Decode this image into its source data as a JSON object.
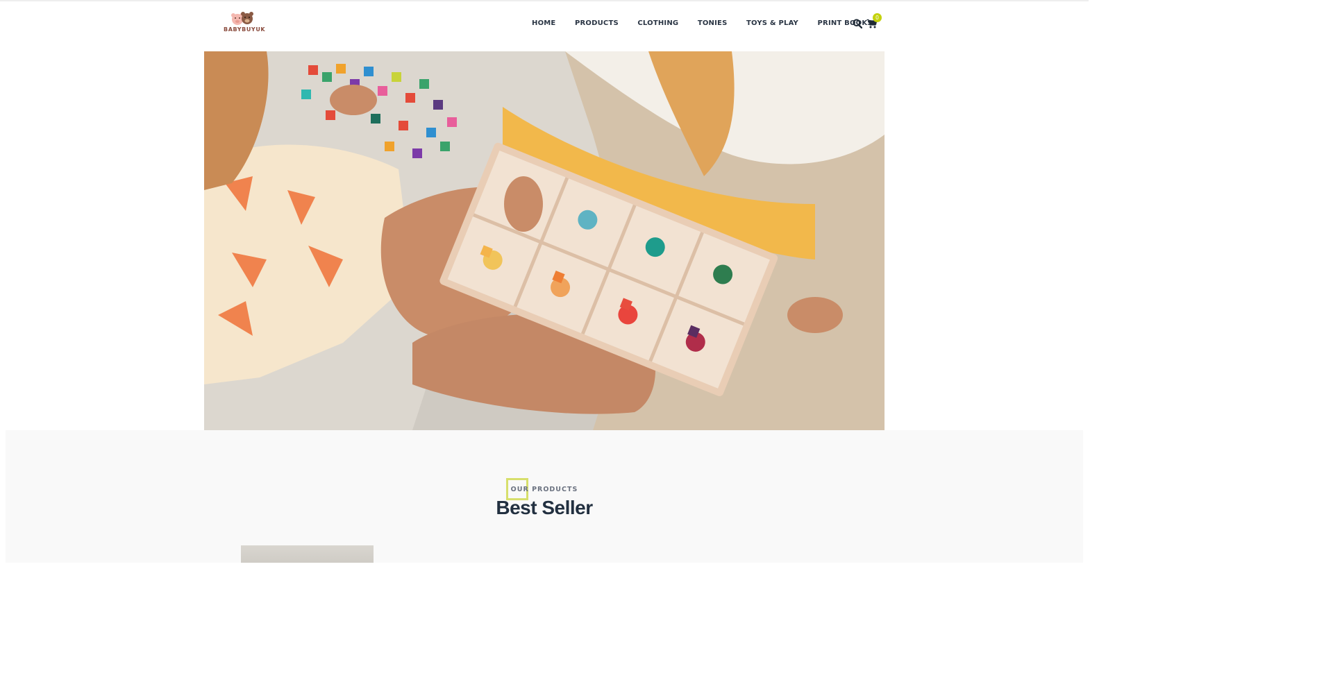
{
  "brand": {
    "logo_text": "BABYBUYUK",
    "logo_icon": "bear-and-pig-mascot-logo"
  },
  "nav": {
    "items": [
      {
        "label": "HOME"
      },
      {
        "label": "PRODUCTS"
      },
      {
        "label": "CLOTHING"
      },
      {
        "label": "TONIES"
      },
      {
        "label": "TOYS & PLAY"
      },
      {
        "label": "PRINT BOOKS"
      }
    ]
  },
  "header_icons": {
    "search": "search-icon",
    "cart": "cart-icon",
    "cart_count": "0"
  },
  "hero": {
    "image_alt_icon": "hero-image",
    "description_colors": {
      "sand": "#d6c5b0",
      "blanket": "#d9d5cf",
      "tray": "#e8cdb8"
    }
  },
  "products": {
    "eyebrow": "OUR PRODUCTS",
    "title": "Best Seller"
  },
  "colors": {
    "accent": "#c4d20d",
    "accent_box": "#d7df6c",
    "text_dark": "#223040",
    "section_bg": "#f9f9f9"
  }
}
